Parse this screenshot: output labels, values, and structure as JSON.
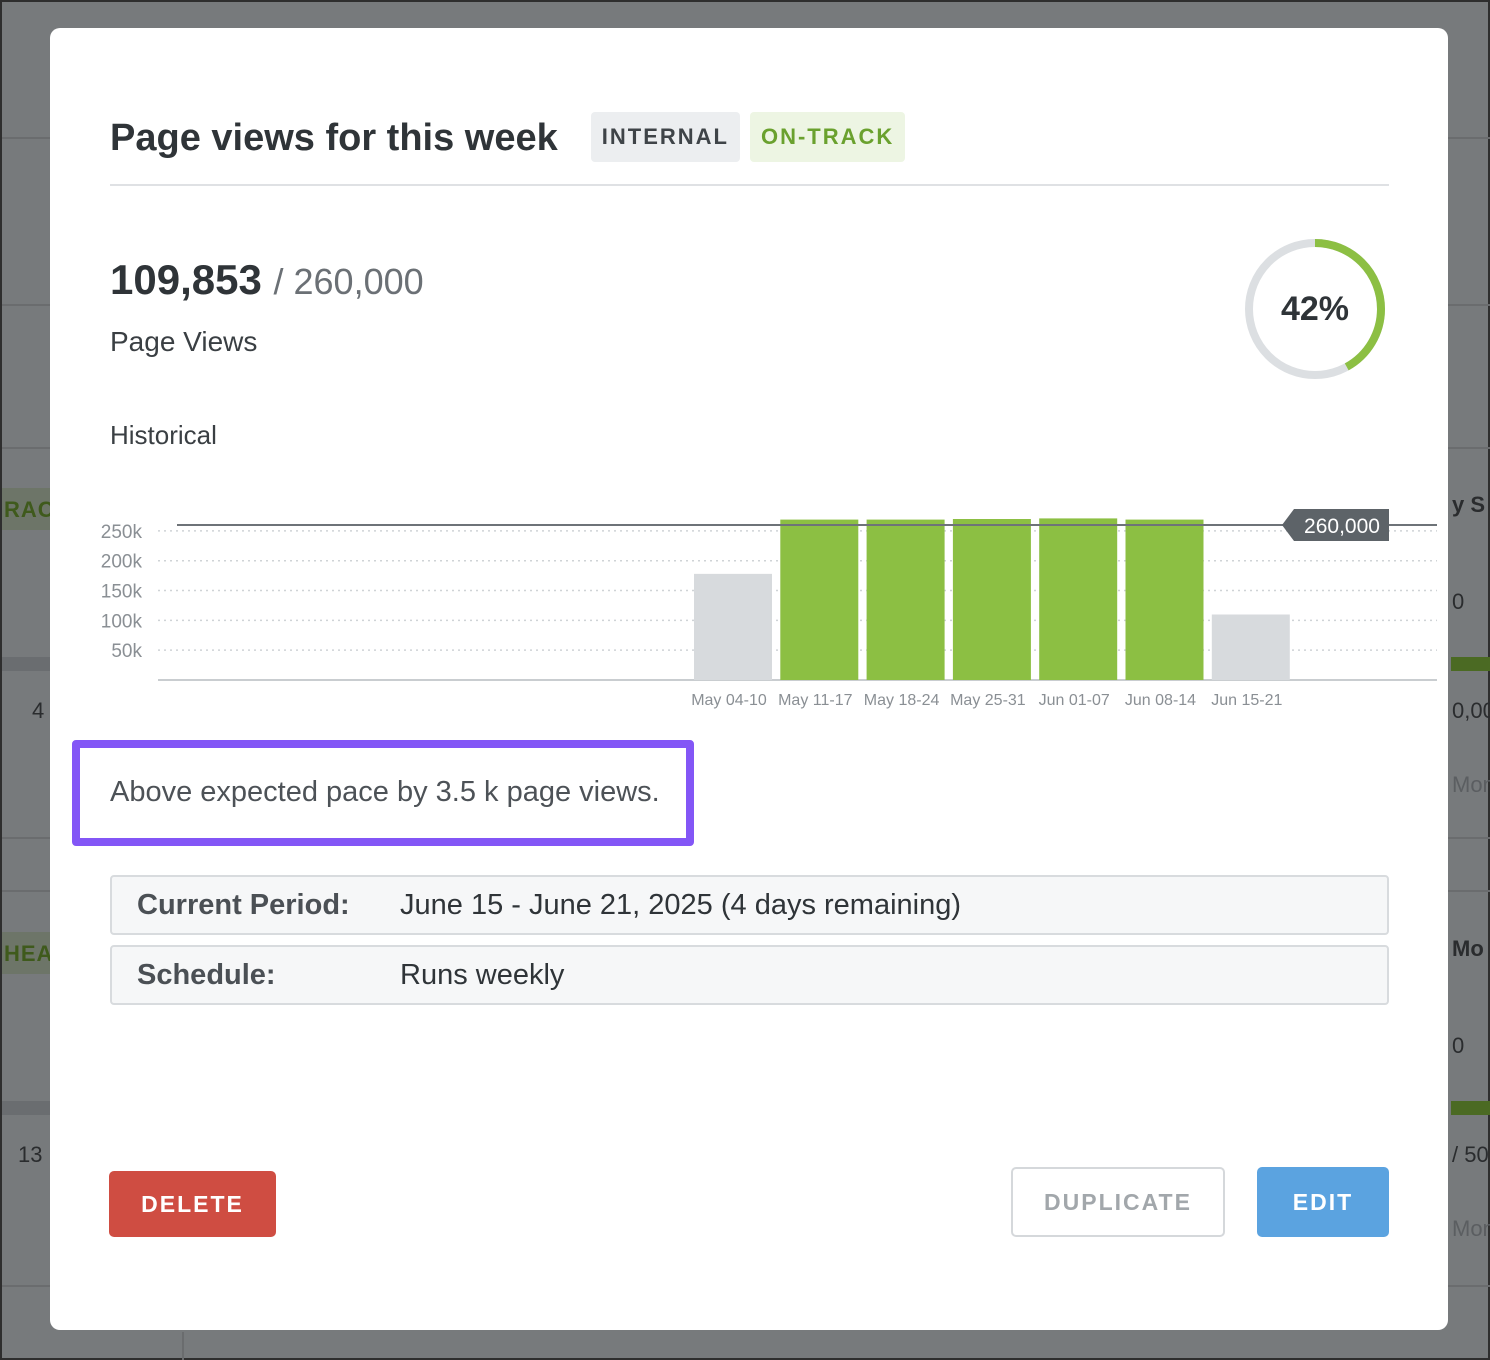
{
  "modal": {
    "title": "Page views for this week",
    "badges": {
      "internal": "INTERNAL",
      "status": "ON-TRACK"
    },
    "metric": {
      "value": "109,853",
      "target": "/ 260,000",
      "label": "Page Views",
      "progress_percent": 42,
      "progress_text": "42%"
    },
    "historical_label": "Historical",
    "pace_message": "Above expected pace by 3.5 k page views.",
    "details": {
      "current_period_label": "Current Period:",
      "current_period_value": "June 15 - June 21, 2025 (4 days remaining)",
      "schedule_label": "Schedule:",
      "schedule_value": "Runs weekly"
    },
    "buttons": {
      "delete": "DELETE",
      "duplicate": "DUPLICATE",
      "edit": "EDIT"
    }
  },
  "chart_data": {
    "type": "bar",
    "categories": [
      "May 04-10",
      "May 11-17",
      "May 18-24",
      "May 25-31",
      "Jun 01-07",
      "Jun 08-14",
      "Jun 15-21"
    ],
    "values": [
      178000,
      269000,
      269000,
      270000,
      271000,
      269000,
      109853
    ],
    "bar_colors": [
      "#d7dadd",
      "#8cbf43",
      "#8cbf43",
      "#8cbf43",
      "#8cbf43",
      "#8cbf43",
      "#d7dadd"
    ],
    "ytick_labels": [
      "50k",
      "100k",
      "150k",
      "200k",
      "250k"
    ],
    "yticks": [
      50000,
      100000,
      150000,
      200000,
      250000
    ],
    "ylim": [
      0,
      270000
    ],
    "target_line": {
      "value": 260000,
      "label": "260,000"
    },
    "grid": true
  },
  "background": {
    "fragments": [
      "RAC",
      "HEA",
      "4",
      "13",
      "y S",
      "0",
      "0,00",
      "Mon",
      "Mo",
      "0",
      "/ 50",
      "Mon"
    ]
  },
  "colors": {
    "accent_green": "#8cbf43",
    "status_green": "#6aa12e",
    "delete_red": "#cf4d42",
    "edit_blue": "#5ba3e0",
    "highlight_purple": "#8356f6"
  }
}
